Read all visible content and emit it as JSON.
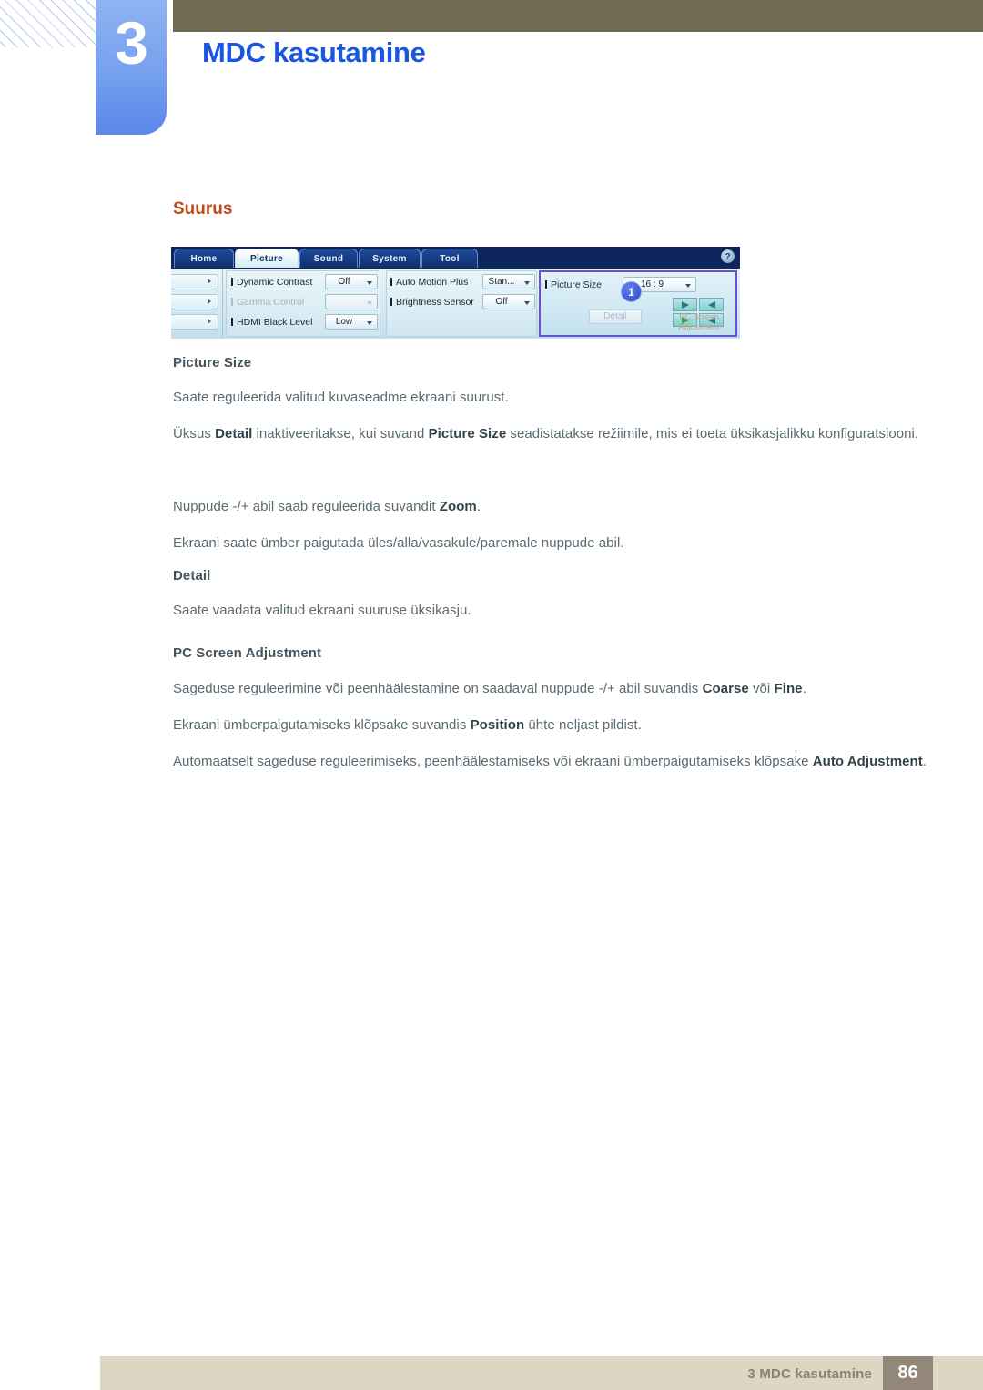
{
  "header": {
    "chapter_number": "3",
    "chapter_title": "MDC kasutamine"
  },
  "section": {
    "heading": "Suurus"
  },
  "mdc_dialog": {
    "tabs": [
      {
        "label": "Home",
        "active": false
      },
      {
        "label": "Picture",
        "active": true
      },
      {
        "label": "Sound",
        "active": false
      },
      {
        "label": "System",
        "active": false
      },
      {
        "label": "Tool",
        "active": false
      }
    ],
    "help_icon": "?",
    "left_column": {
      "rows": [
        {
          "label": "Dynamic Contrast",
          "value": "Off",
          "disabled": false
        },
        {
          "label": "Gamma Control",
          "value": "",
          "disabled": true
        },
        {
          "label": "HDMI Black Level",
          "value": "Low",
          "disabled": false
        }
      ]
    },
    "middle_column": {
      "rows": [
        {
          "label": "Auto Motion Plus",
          "value": "Stan...",
          "disabled": false
        },
        {
          "label": "Brightness Sensor",
          "value": "Off",
          "disabled": false
        }
      ]
    },
    "right_column": {
      "badge": "1",
      "rows": [
        {
          "label": "Picture Size",
          "value": "16 : 9",
          "disabled": false
        }
      ],
      "detail_button": "Detail",
      "pc_screen_adjustment_label": "PC Screen\nAdjustment",
      "pc_screen_adjustment_line1": "PC Screen",
      "pc_screen_adjustment_line2": "Adjustment"
    }
  },
  "content": {
    "picture_size_heading": "Picture Size",
    "picture_size_p1": "Saate reguleerida valitud kuvaseadme ekraani suurust.",
    "picture_size_p2_a": "Üksus ",
    "picture_size_p2_b1": "Detail",
    "picture_size_p2_c": " inaktiveeritakse, kui suvand ",
    "picture_size_p2_b2": "Picture Size",
    "picture_size_p2_d": " seadistatakse režiimile, mis ei toeta üksikasjalikku konfiguratsiooni.",
    "picture_size_p3_a": "Nuppude -/+ abil saab reguleerida suvandit ",
    "picture_size_p3_b": "Zoom",
    "picture_size_p3_c": ".",
    "picture_size_p4": "Ekraani saate ümber paigutada üles/alla/vasakule/paremale nuppude abil.",
    "detail_heading": "Detail",
    "detail_p1": "Saate vaadata valitud ekraani suuruse üksikasju.",
    "pcsa_heading": "PC Screen Adjustment",
    "pcsa_p1_a": "Sageduse reguleerimine või peenhäälestamine on saadaval nuppude -/+ abil suvandis ",
    "pcsa_p1_b1": "Coarse",
    "pcsa_p1_c": " või ",
    "pcsa_p1_b2": "Fine",
    "pcsa_p1_d": ".",
    "pcsa_p2_a": "Ekraani ümberpaigutamiseks klõpsake suvandis ",
    "pcsa_p2_b": "Position",
    "pcsa_p2_c": " ühte neljast pildist.",
    "pcsa_p3_a": "Automaatselt sageduse reguleerimiseks, peenhäälestamiseks või ekraani ümberpaigutamiseks klõpsake ",
    "pcsa_p3_b": "Auto Adjustment",
    "pcsa_p3_c": "."
  },
  "footer": {
    "label": "3 MDC kasutamine",
    "page_number": "86"
  },
  "colors": {
    "chapter_tab": "#7ba4ef",
    "chapter_title": "#1a57e0",
    "olive_bar": "#6f6b53",
    "section_heading": "#c0491a",
    "body_text": "#5a6a72",
    "sub_heading": "#44535c",
    "footer_bar": "#ddd6c3",
    "footer_page_box": "#938779",
    "highlight_outline": "#6a4fd8"
  }
}
